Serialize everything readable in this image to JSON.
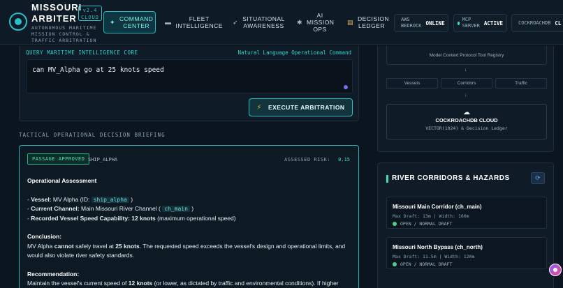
{
  "header": {
    "brand_title": "MISSOURI ARBITER",
    "version": "v2.4 CLOUD",
    "brand_sub": "AUTONOMOUS MARITIME MISSION CONTROL & TRAFFIC ARBITRATION",
    "nav": [
      {
        "label": "COMMAND CENTER",
        "icon": "✦"
      },
      {
        "label": "FLEET INTELLIGENCE",
        "icon": "▬"
      },
      {
        "label": "SITUATIONAL AWARENESS",
        "icon": "➶"
      },
      {
        "label": "AI MISSION OPS",
        "icon": "✱"
      },
      {
        "label": "DECISION LEDGER",
        "icon": "▤"
      }
    ],
    "status": [
      {
        "name": "AWS BEDROCK",
        "state": "ONLINE"
      },
      {
        "name": "MCP SERVER",
        "state": "ACTIVE"
      },
      {
        "name": "COCKROACHDB",
        "state": "CL"
      }
    ]
  },
  "query": {
    "label": "QUERY MARITIME INTELLIGENCE CORE",
    "mode": "Natural Language Operational Command",
    "text": "can MV_Alpha go at 25 knots speed",
    "execute_label": "EXECUTE ARBITRATION"
  },
  "briefing": {
    "title": "TACTICAL OPERATIONAL DECISION BRIEFING",
    "badge": "PASSAGE APPROVED",
    "ship": "SHIP_ALPHA",
    "risk_label": "ASSESSED RISK:",
    "risk_value": "0.15",
    "heading": "Operational Assessment",
    "vessel_label": "Vessel:",
    "vessel_value": "MV Alpha (ID:",
    "vessel_id": "ship_alpha",
    "channel_label": "Current Channel:",
    "channel_value": "Main Missouri River Channel (",
    "channel_id": "ch_main",
    "speed_label": "Recorded Vessel Speed Capability: 12 knots",
    "speed_note": "(maximum operational speed)",
    "conclusion_heading": "Conclusion:",
    "conclusion_a": "MV Alpha",
    "conclusion_b": "cannot",
    "conclusion_c": "safely travel at",
    "conclusion_d": "25 knots",
    "conclusion_e": ". The requested speed exceeds the vessel's design and operational limits, and would also violate river safety standards.",
    "recommendation_heading": "Recommendation:",
    "recommendation_a": "Maintain the vessel's current speed of",
    "recommendation_b": "12 knots",
    "recommendation_c": "(or lower, as dictated by traffic and environmental conditions). If higher"
  },
  "mcp": {
    "registry": "Model Context Protocol Tool Registry",
    "tags": [
      "Vessels",
      "Corridors",
      "Traffic"
    ],
    "db_name": "COCKROACHDB CLOUD",
    "db_sub": "VECTOR(1024) & Decision Ledger"
  },
  "corridors": {
    "title": "RIVER CORRIDORS & HAZARDS",
    "items": [
      {
        "name": "Missouri Main Corridor (ch_main)",
        "meta": "Max Draft: 13m | Width: 160m",
        "status": "OPEN / NORMAL DRAFT"
      },
      {
        "name": "Missouri North Bypass (ch_north)",
        "meta": "Max Draft: 11.5m | Width: 120m",
        "status": "OPEN / NORMAL DRAFT"
      }
    ]
  }
}
